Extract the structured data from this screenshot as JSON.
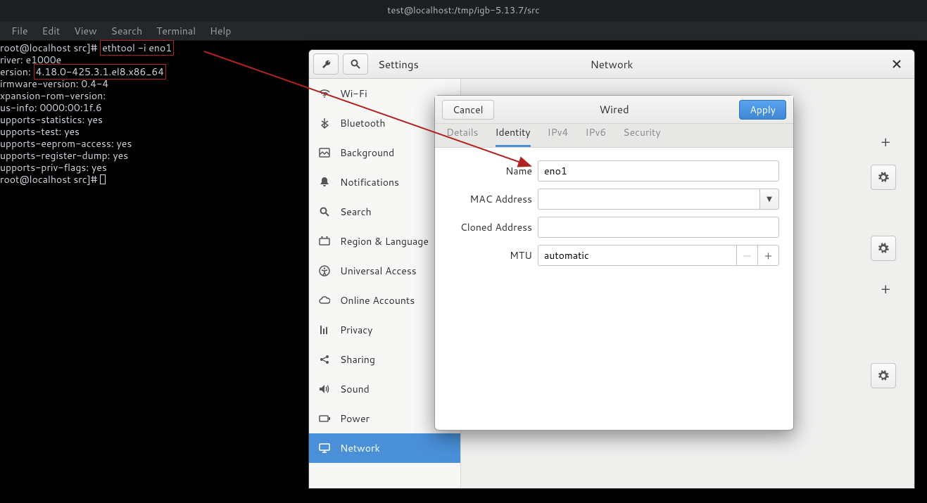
{
  "titlebar": "test@localhost:/tmp/igb-5.13.7/src",
  "term_menu": [
    "File",
    "Edit",
    "View",
    "Search",
    "Terminal",
    "Help"
  ],
  "terminal": {
    "prompt1_a": "root@localhost src]# ",
    "cmd": "ethtool -i eno1",
    "lines_mid_a": "river: e1000e\nersion: ",
    "version": "4.18.0-425.3.1.el8.x86_64",
    "lines_mid_b": "\nirmware-version: 0.4-4\nxpansion-rom-version:\nus-info: 0000:00:1f.6\nupports-statistics: yes\nupports-test: yes\nupports-eeprom-access: yes\nupports-register-dump: yes\nupports-priv-flags: yes\nroot@localhost src]# "
  },
  "settings": {
    "title_left": "Settings",
    "title_center": "Network",
    "sidebar": [
      {
        "label": "Wi-Fi"
      },
      {
        "label": "Bluetooth"
      },
      {
        "label": "Background"
      },
      {
        "label": "Notifications"
      },
      {
        "label": "Search"
      },
      {
        "label": "Region & Language"
      },
      {
        "label": "Universal Access"
      },
      {
        "label": "Online Accounts"
      },
      {
        "label": "Privacy"
      },
      {
        "label": "Sharing"
      },
      {
        "label": "Sound"
      },
      {
        "label": "Power"
      },
      {
        "label": "Network"
      }
    ]
  },
  "dialog": {
    "cancel": "Cancel",
    "apply": "Apply",
    "title": "Wired",
    "tabs": [
      "Details",
      "Identity",
      "IPv4",
      "IPv6",
      "Security"
    ],
    "active_tab": 1,
    "labels": {
      "name": "Name",
      "mac": "MAC Address",
      "cloned": "Cloned Address",
      "mtu": "MTU"
    },
    "values": {
      "name": "eno1",
      "mac": "",
      "cloned": "",
      "mtu": "automatic"
    }
  }
}
